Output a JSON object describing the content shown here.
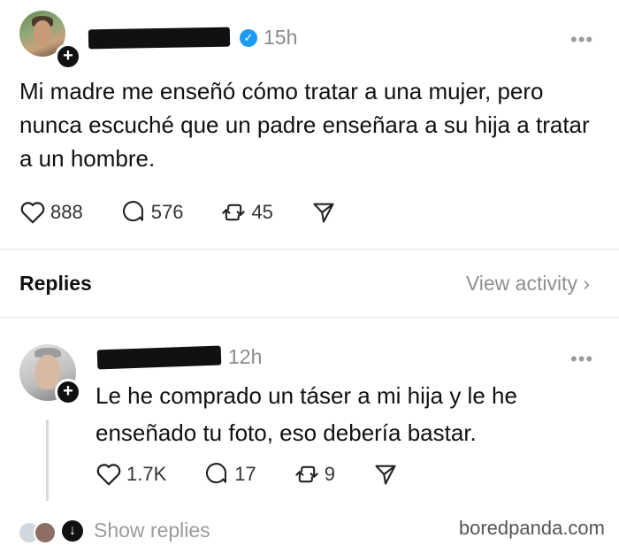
{
  "post": {
    "time": "15h",
    "more": "•••",
    "text": "Mi madre me enseñó cómo tratar a una mujer, pero nunca escuché que un padre enseñara a su hija a tratar a un hombre.",
    "likes": "888",
    "comments": "576",
    "reposts": "45"
  },
  "replies_header": {
    "label": "Replies",
    "view_activity": "View activity ›"
  },
  "reply": {
    "time": "12h",
    "more": "•••",
    "text": "Le he comprado un táser a mi hija y le he enseñado tu foto, eso debería bastar.",
    "likes": "1.7K",
    "comments": "17",
    "reposts": "9"
  },
  "footer": {
    "show_replies": "Show replies",
    "watermark": "boredpanda.com"
  },
  "colors": {
    "accent": "#1d9bf0",
    "muted": "#8a8a8a"
  }
}
